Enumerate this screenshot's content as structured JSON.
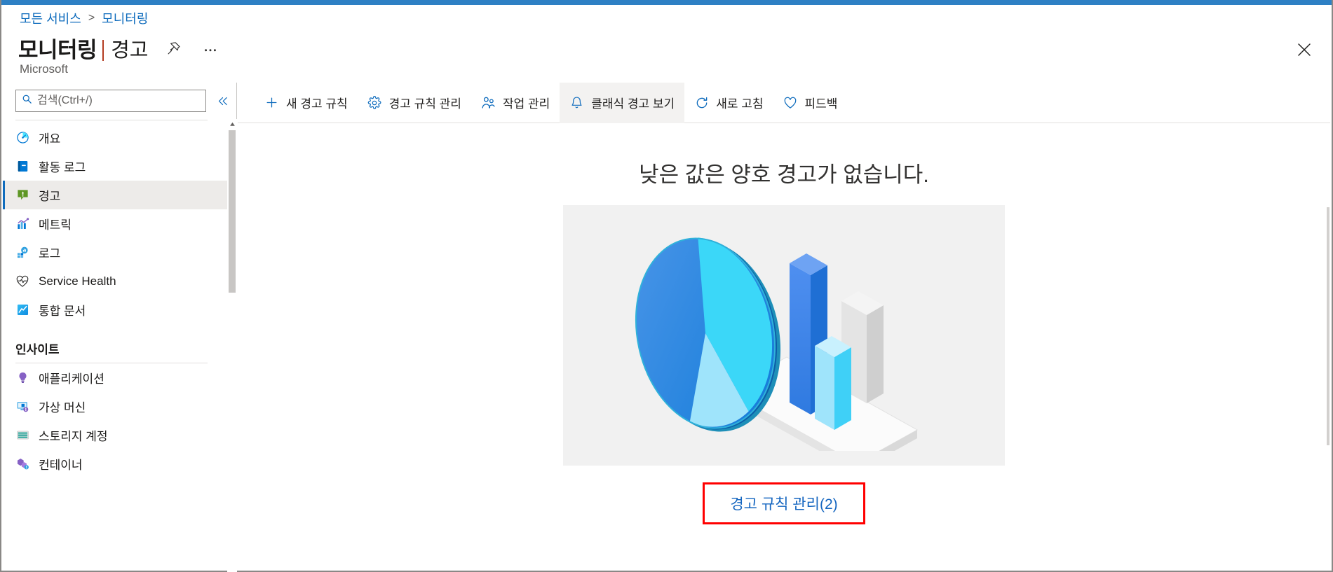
{
  "theme": {
    "accent": "#0f6cbd",
    "topbar": "#2e80c4",
    "link": "#1566c0",
    "highlight_box_border": "#ff0000",
    "selected_nav_bg": "#edebe9",
    "illustration_bg": "#f1f1f1"
  },
  "breadcrumb": {
    "items": [
      "모든 서비스",
      "모니터링"
    ],
    "separator": ">"
  },
  "header": {
    "title": "모니터링",
    "section": "경고",
    "subtitle": "Microsoft",
    "pin_icon": "pin-icon",
    "more_icon": "ellipsis-icon",
    "close_icon": "close-icon"
  },
  "search": {
    "placeholder": "검색(Ctrl+/)",
    "value": "",
    "icon": "search-icon",
    "collapse_icon": "chevron-double-left-icon"
  },
  "sidebar": {
    "items": [
      {
        "label": "개요",
        "icon": "overview-gauge-icon",
        "selected": false
      },
      {
        "label": "활동 로그",
        "icon": "activity-log-icon",
        "selected": false
      },
      {
        "label": "경고",
        "icon": "alert-icon",
        "selected": true
      },
      {
        "label": "메트릭",
        "icon": "metrics-chart-icon",
        "selected": false
      },
      {
        "label": "로그",
        "icon": "logs-icon",
        "selected": false
      },
      {
        "label": "Service Health",
        "icon": "heart-pulse-icon",
        "selected": false
      },
      {
        "label": "통합 문서",
        "icon": "workbooks-icon",
        "selected": false
      }
    ],
    "group": {
      "title": "인사이트",
      "items": [
        {
          "label": "애플리케이션",
          "icon": "application-insights-icon"
        },
        {
          "label": "가상 머신",
          "icon": "virtual-machine-icon"
        },
        {
          "label": "스토리지 계정",
          "icon": "storage-account-icon"
        },
        {
          "label": "컨테이너",
          "icon": "container-icon"
        }
      ]
    }
  },
  "toolbar": {
    "buttons": [
      {
        "label": "새 경고 규칙",
        "icon": "plus-icon",
        "active": false
      },
      {
        "label": "경고 규칙 관리",
        "icon": "gear-icon",
        "active": false
      },
      {
        "label": "작업 관리",
        "icon": "people-icon",
        "active": false
      },
      {
        "label": "클래식 경고 보기",
        "icon": "bell-icon",
        "active": true
      },
      {
        "label": "새로 고침",
        "icon": "refresh-icon",
        "active": false
      },
      {
        "label": "피드백",
        "icon": "heart-icon",
        "active": false
      }
    ]
  },
  "main": {
    "empty_state": {
      "heading": "낮은 값은 양호 경고가 없습니다.",
      "illustration": "isometric-pie-and-bar-chart-illustration",
      "link_label": "경고 규칙 관리(2)"
    }
  }
}
